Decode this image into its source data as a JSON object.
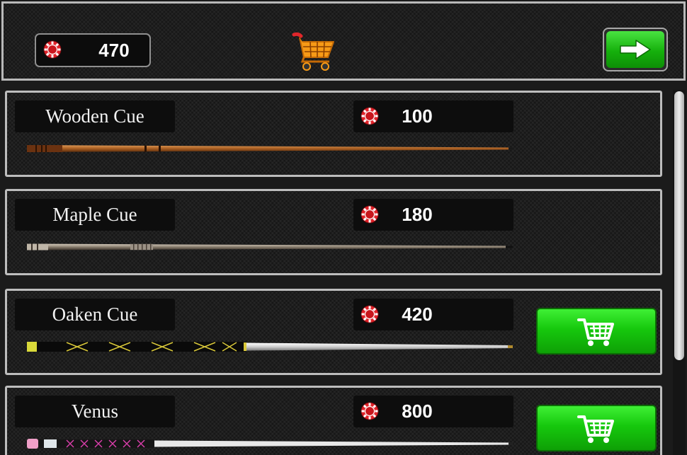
{
  "header": {
    "balance": "470",
    "chip_icon": "poker-chip-icon",
    "cart_icon": "shopping-cart-icon",
    "next_icon": "arrow-right-icon"
  },
  "cues": [
    {
      "name": "Wooden Cue",
      "price": "100",
      "purchasable": false
    },
    {
      "name": "Maple Cue",
      "price": "180",
      "purchasable": false
    },
    {
      "name": "Oaken Cue",
      "price": "420",
      "purchasable": true
    },
    {
      "name": "Venus",
      "price": "800",
      "purchasable": true
    }
  ],
  "colors": {
    "chip_red": "#e1232a",
    "button_green": "#16c80d",
    "cart_orange": "#f79a16",
    "panel_border": "#bdbdbd"
  }
}
